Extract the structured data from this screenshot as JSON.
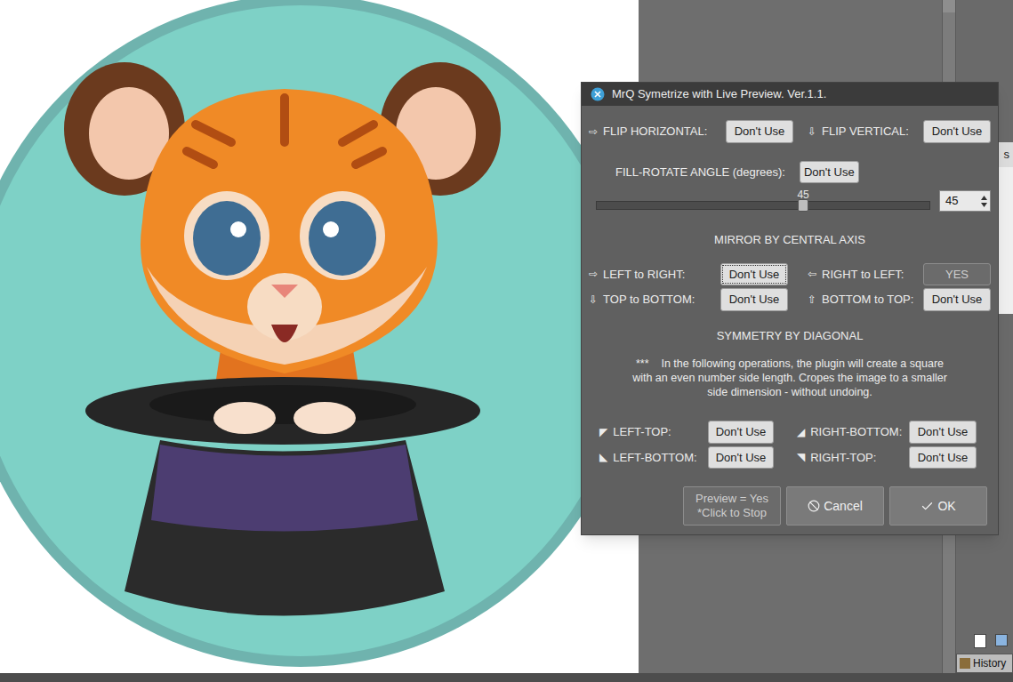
{
  "window": {
    "title": "MrQ Symetrize with Live Preview. Ver.1.1."
  },
  "flip": [
    {
      "icon": "⇨",
      "label": "FLIP HORIZONTAL:",
      "button": "Don't Use",
      "selected": false
    },
    {
      "icon": "⇩",
      "label": "FLIP VERTICAL:",
      "button": "Don't Use",
      "selected": false
    }
  ],
  "fill_rotate": {
    "label": "FILL-ROTATE ANGLE (degrees):",
    "button": "Don't Use",
    "selected": false,
    "slider_reading": "45",
    "level": 0.62,
    "spinbox": "45"
  },
  "mirror": {
    "title": "MIRROR BY CENTRAL AXIS",
    "items": [
      {
        "icon": "⇨",
        "label": "LEFT to RIGHT:",
        "button": "Don't Use",
        "selected": false,
        "focused": true
      },
      {
        "icon": "⇦",
        "label": "RIGHT to LEFT:",
        "button": "YES",
        "selected": true,
        "focused": false
      },
      {
        "icon": "⇩",
        "label": "TOP to BOTTOM:",
        "button": "Don't Use",
        "selected": false,
        "focused": false
      },
      {
        "icon": "⇧",
        "label": "BOTTOM to TOP:",
        "button": "Don't Use",
        "selected": false,
        "focused": false
      }
    ]
  },
  "diagonal": {
    "title": "SYMMETRY BY DIAGONAL",
    "note": [
      "***    In the following operations, the plugin will create a square",
      "with an even number side length. Cropes the image to a smaller",
      "side dimension - without undoing."
    ],
    "items": [
      {
        "icon": "◤",
        "label": "LEFT-TOP:",
        "button": "Don't Use",
        "selected": false
      },
      {
        "icon": "◢",
        "label": "RIGHT-BOTTOM:",
        "button": "Don't Use",
        "selected": false
      },
      {
        "icon": "◣",
        "label": "LEFT-BOTTOM:",
        "button": "Don't Use",
        "selected": false
      },
      {
        "icon": "◥",
        "label": "RIGHT-TOP:",
        "button": "Don't Use",
        "selected": false
      }
    ]
  },
  "actions": {
    "preview": {
      "lines": [
        "Preview = Yes",
        "*Click to Stop"
      ],
      "on": true
    },
    "cancel": "Cancel",
    "ok": "OK"
  },
  "dock": {
    "partial_label": "s",
    "tab": "History"
  }
}
